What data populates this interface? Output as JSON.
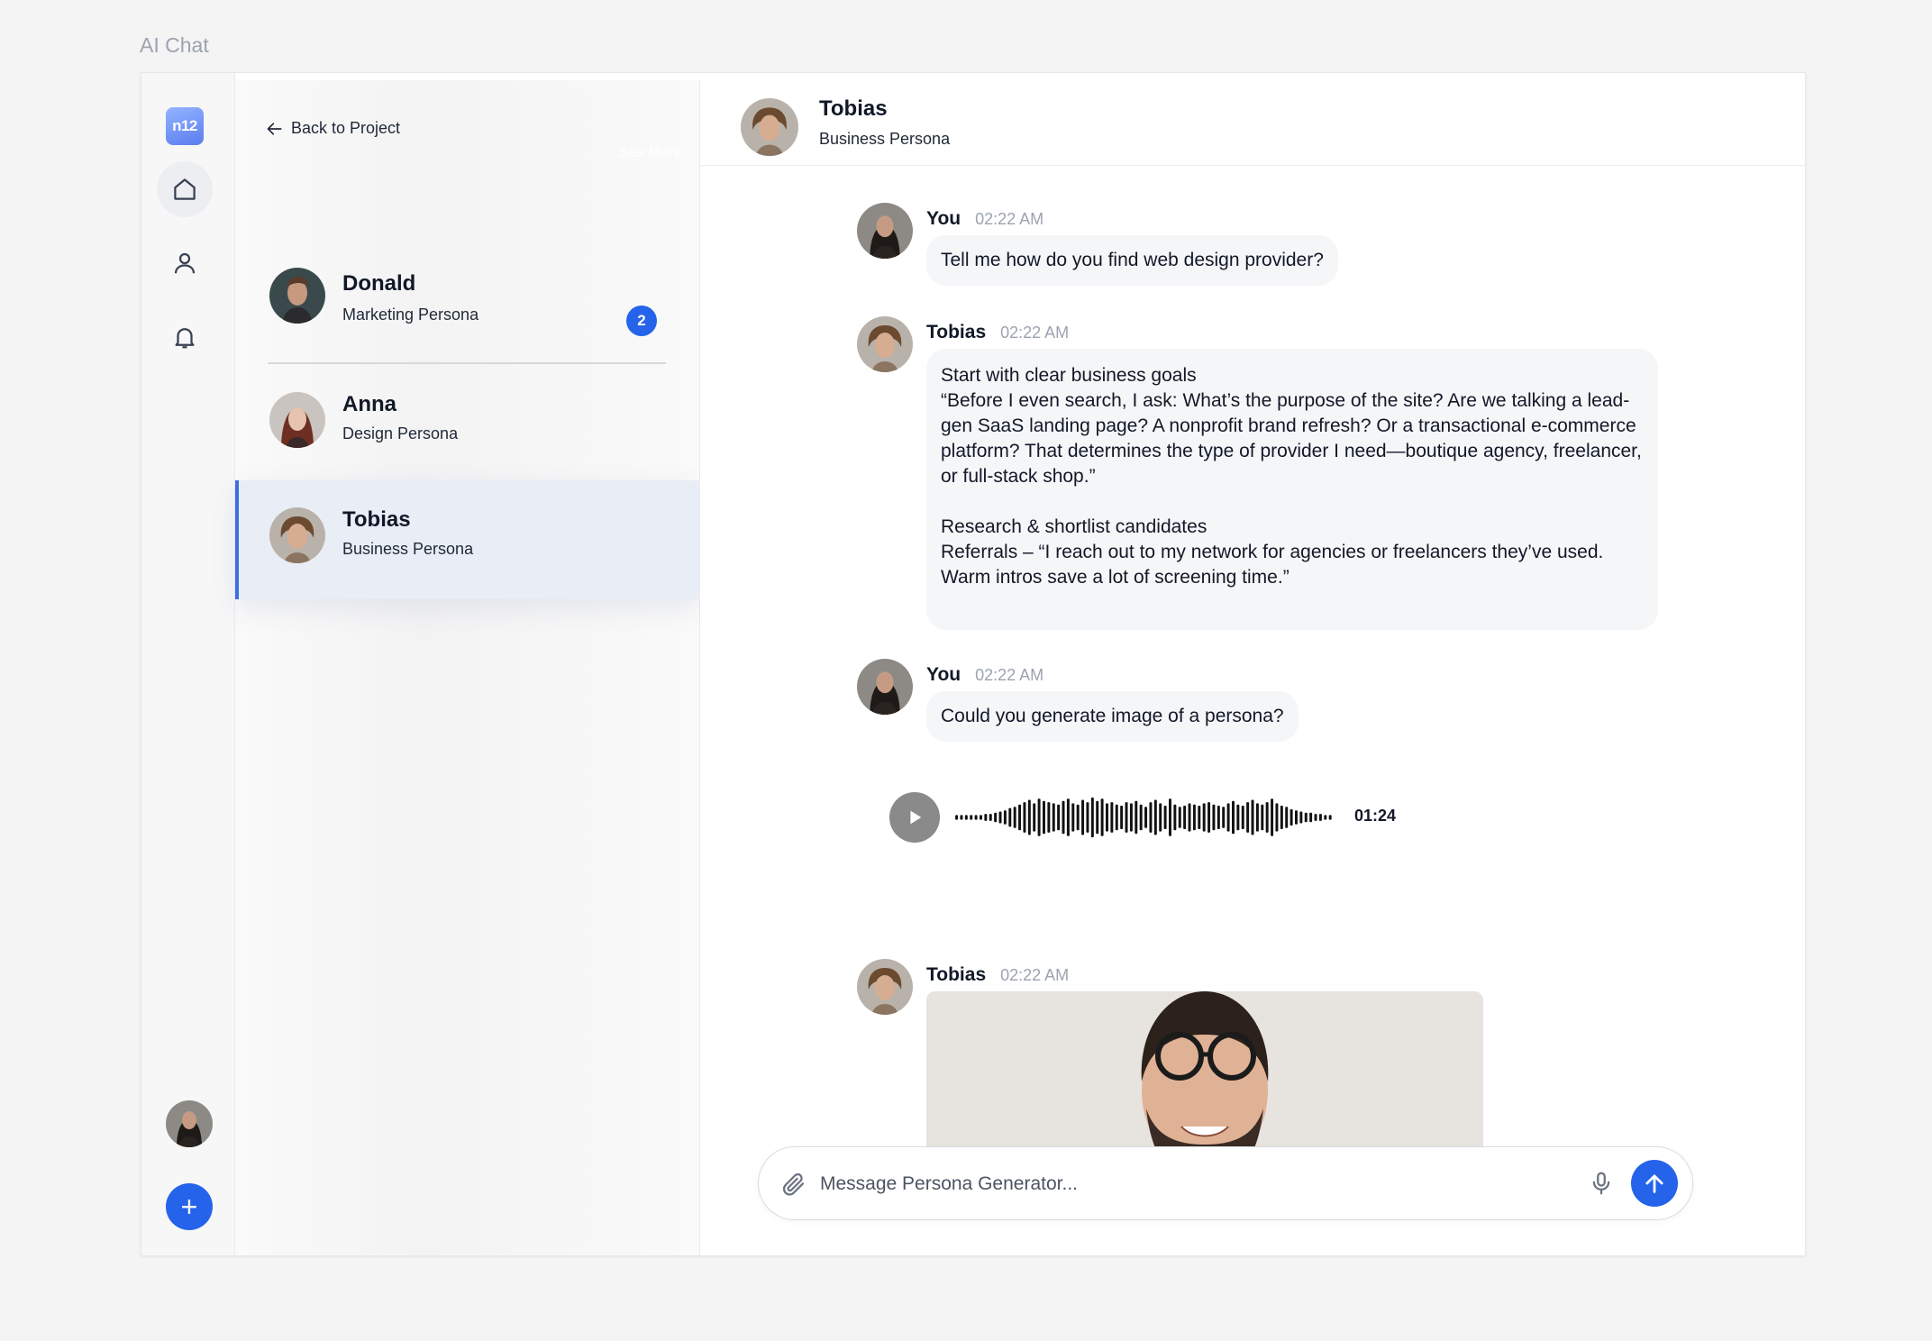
{
  "page": {
    "label": "AI Chat"
  },
  "nav": {
    "logo_text": "n12",
    "icons": [
      "home-icon",
      "user-icon",
      "bell-icon"
    ],
    "add_label": "+"
  },
  "list": {
    "back_label": "Back to Project",
    "see_more": "See More",
    "items": [
      {
        "name": "Donald",
        "role": "Marketing Persona",
        "badge": "2"
      },
      {
        "name": "Anna",
        "role": "Design Persona"
      },
      {
        "name": "Tobias",
        "role": "Business Persona"
      }
    ]
  },
  "chat": {
    "title": "Tobias",
    "subtitle": "Business Persona",
    "messages": [
      {
        "author": "You",
        "time": "02:22 AM",
        "text": "Tell me how do you find web design provider?"
      },
      {
        "author": "Tobias",
        "time": "02:22 AM",
        "text": "Start with clear business goals\n“Before I even search, I ask: What’s the purpose of the site? Are we talking a lead-gen SaaS landing page? A nonprofit brand refresh? Or a transactional e-commerce platform? That determines the type of provider I need—boutique agency, freelancer, or full-stack shop.”\n\nResearch & shortlist candidates\n Referrals – “I reach out to my network for agencies or freelancers they’ve used. Warm intros save a lot of screening time.”"
      },
      {
        "author": "You",
        "time": "02:22 AM",
        "text": "Could you generate image of a persona?"
      },
      {
        "author": "Tobias",
        "time": "02:22 AM"
      }
    ],
    "voice": {
      "duration": "01:24",
      "bars": [
        2,
        2,
        2,
        2,
        2,
        2,
        3,
        3,
        4,
        5,
        6,
        8,
        9,
        11,
        13,
        15,
        12,
        16,
        14,
        13,
        12,
        11,
        14,
        16,
        12,
        11,
        15,
        13,
        17,
        14,
        16,
        12,
        13,
        11,
        10,
        13,
        12,
        14,
        11,
        9,
        13,
        15,
        12,
        10,
        16,
        11,
        9,
        10,
        12,
        11,
        10,
        12,
        13,
        11,
        10,
        9,
        12,
        14,
        11,
        10,
        13,
        15,
        12,
        11,
        13,
        16,
        12,
        10,
        9,
        7,
        6,
        5,
        4,
        4,
        3,
        3,
        2,
        2
      ]
    },
    "composer": {
      "placeholder": "Message Persona Generator..."
    }
  },
  "colors": {
    "accent": "#2563eb",
    "selected_bg": "#e9edf6",
    "bubble_bg": "#f5f6f8"
  }
}
